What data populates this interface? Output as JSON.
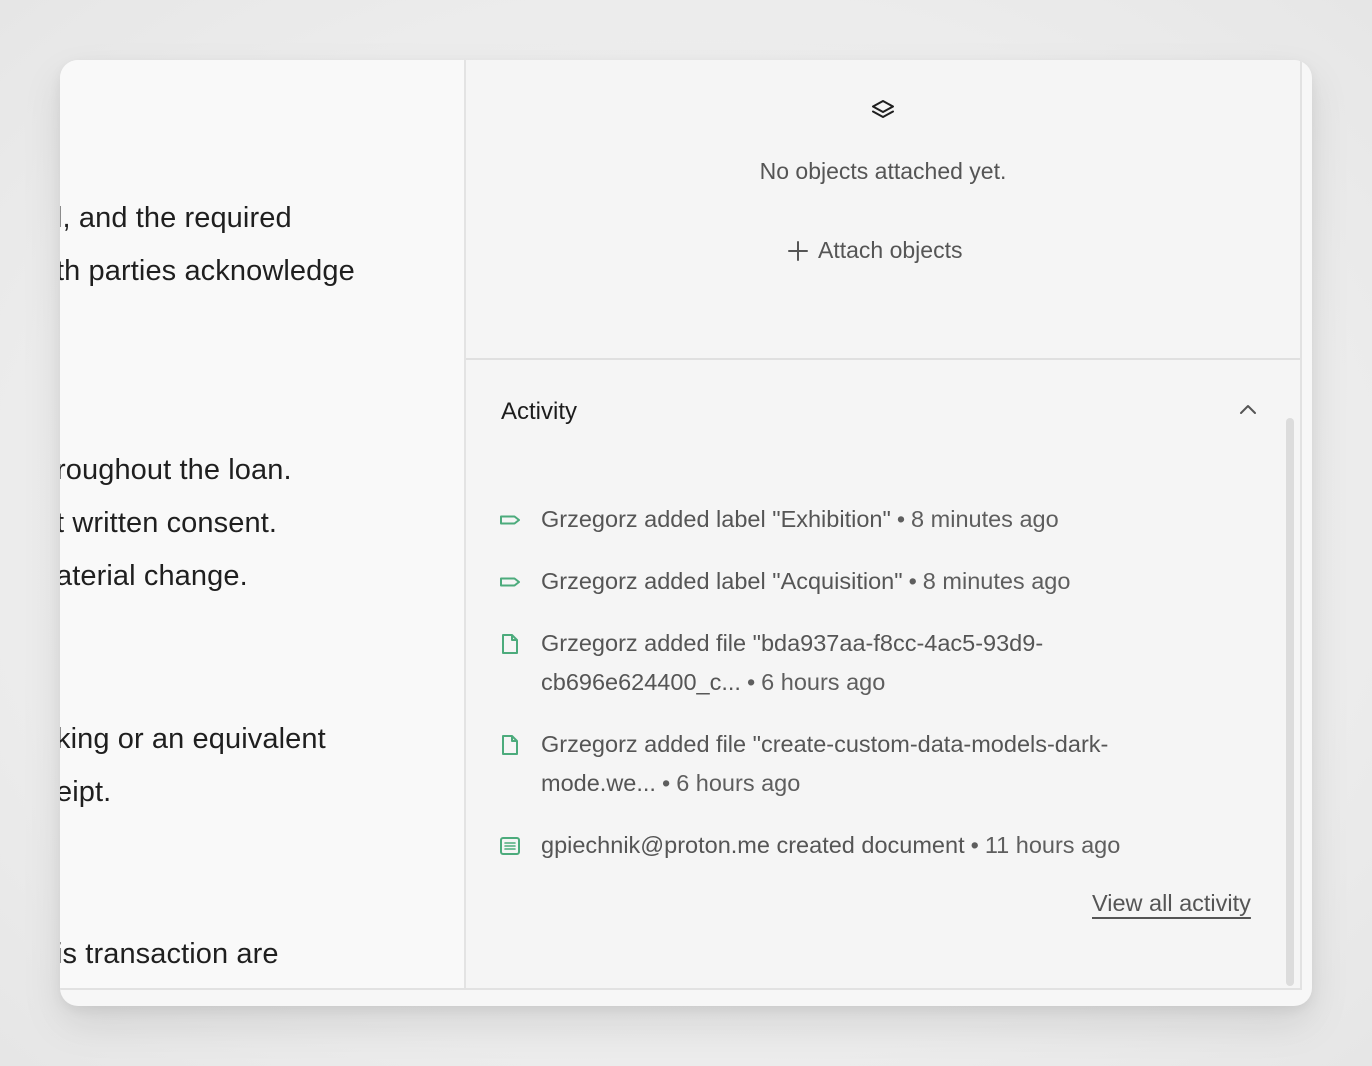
{
  "document": {
    "lines": [
      "l, and the required",
      "th parties acknowledge",
      "roughout the loan.",
      "t written consent.",
      "aterial change.",
      "king or an equivalent",
      "eipt.",
      "is transaction are"
    ]
  },
  "objects": {
    "icon": "layers-icon",
    "empty_text": "No objects attached yet.",
    "attach_label": "Attach objects",
    "attach_icon": "plus-icon"
  },
  "activity": {
    "title": "Activity",
    "collapse_icon": "chevron-up-icon",
    "accent_color": "#4cab7c",
    "items": [
      {
        "icon": "tag-icon",
        "text": "Grzegorz added label \"Exhibition\"",
        "time": "8 minutes ago"
      },
      {
        "icon": "tag-icon",
        "text": "Grzegorz added label \"Acquisition\"",
        "time": "8 minutes ago"
      },
      {
        "icon": "file-icon",
        "text": "Grzegorz added file \"bda937aa-f8cc-4ac5-93d9-cb696e624400_c...",
        "time": "6 hours ago"
      },
      {
        "icon": "file-icon",
        "text": "Grzegorz added file \"create-custom-data-models-dark-mode.we...",
        "time": "6 hours ago"
      },
      {
        "icon": "document-icon",
        "text": "gpiechnik@proton.me created document",
        "time": "11 hours ago"
      }
    ],
    "view_all_label": "View all activity"
  }
}
